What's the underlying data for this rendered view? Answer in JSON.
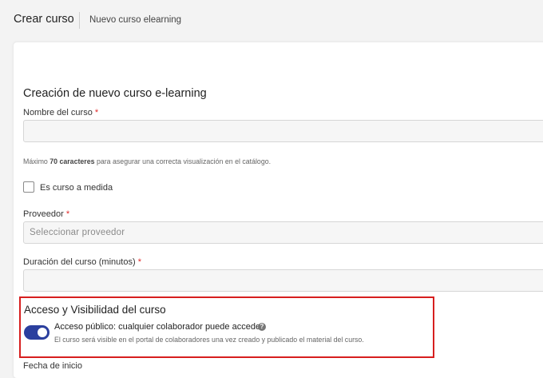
{
  "header": {
    "title": "Crear curso",
    "subtitle": "Nuevo curso elearning"
  },
  "form": {
    "title": "Creación de nuevo curso e-learning",
    "course_name": {
      "label": "Nombre del curso",
      "required_mark": "*",
      "value": ""
    },
    "hint": {
      "prefix": "Máximo ",
      "bold": "70 caracteres",
      "suffix": " para asegurar una correcta visualización en el catálogo."
    },
    "custom_course": {
      "label": "Es curso a medida",
      "checked": false
    },
    "provider": {
      "label": "Proveedor",
      "required_mark": "*",
      "placeholder": "Seleccionar proveedor"
    },
    "duration": {
      "label": "Duración del curso (minutos)",
      "required_mark": "*",
      "value": ""
    }
  },
  "visibility": {
    "title": "Acceso y Visibilidad del curso",
    "public_access": {
      "label": "Acceso público: cualquier colaborador puede acceder",
      "enabled": true,
      "help_icon": "question-circle-icon",
      "description": "El curso será visible en el portal de colaboradores una vez creado y publicado el material del curso."
    },
    "next_label": "Fecha de inicio"
  },
  "colors": {
    "toggle_on": "#2b3f9e",
    "required": "#e02a2a",
    "highlight_border": "#d71f1f"
  }
}
